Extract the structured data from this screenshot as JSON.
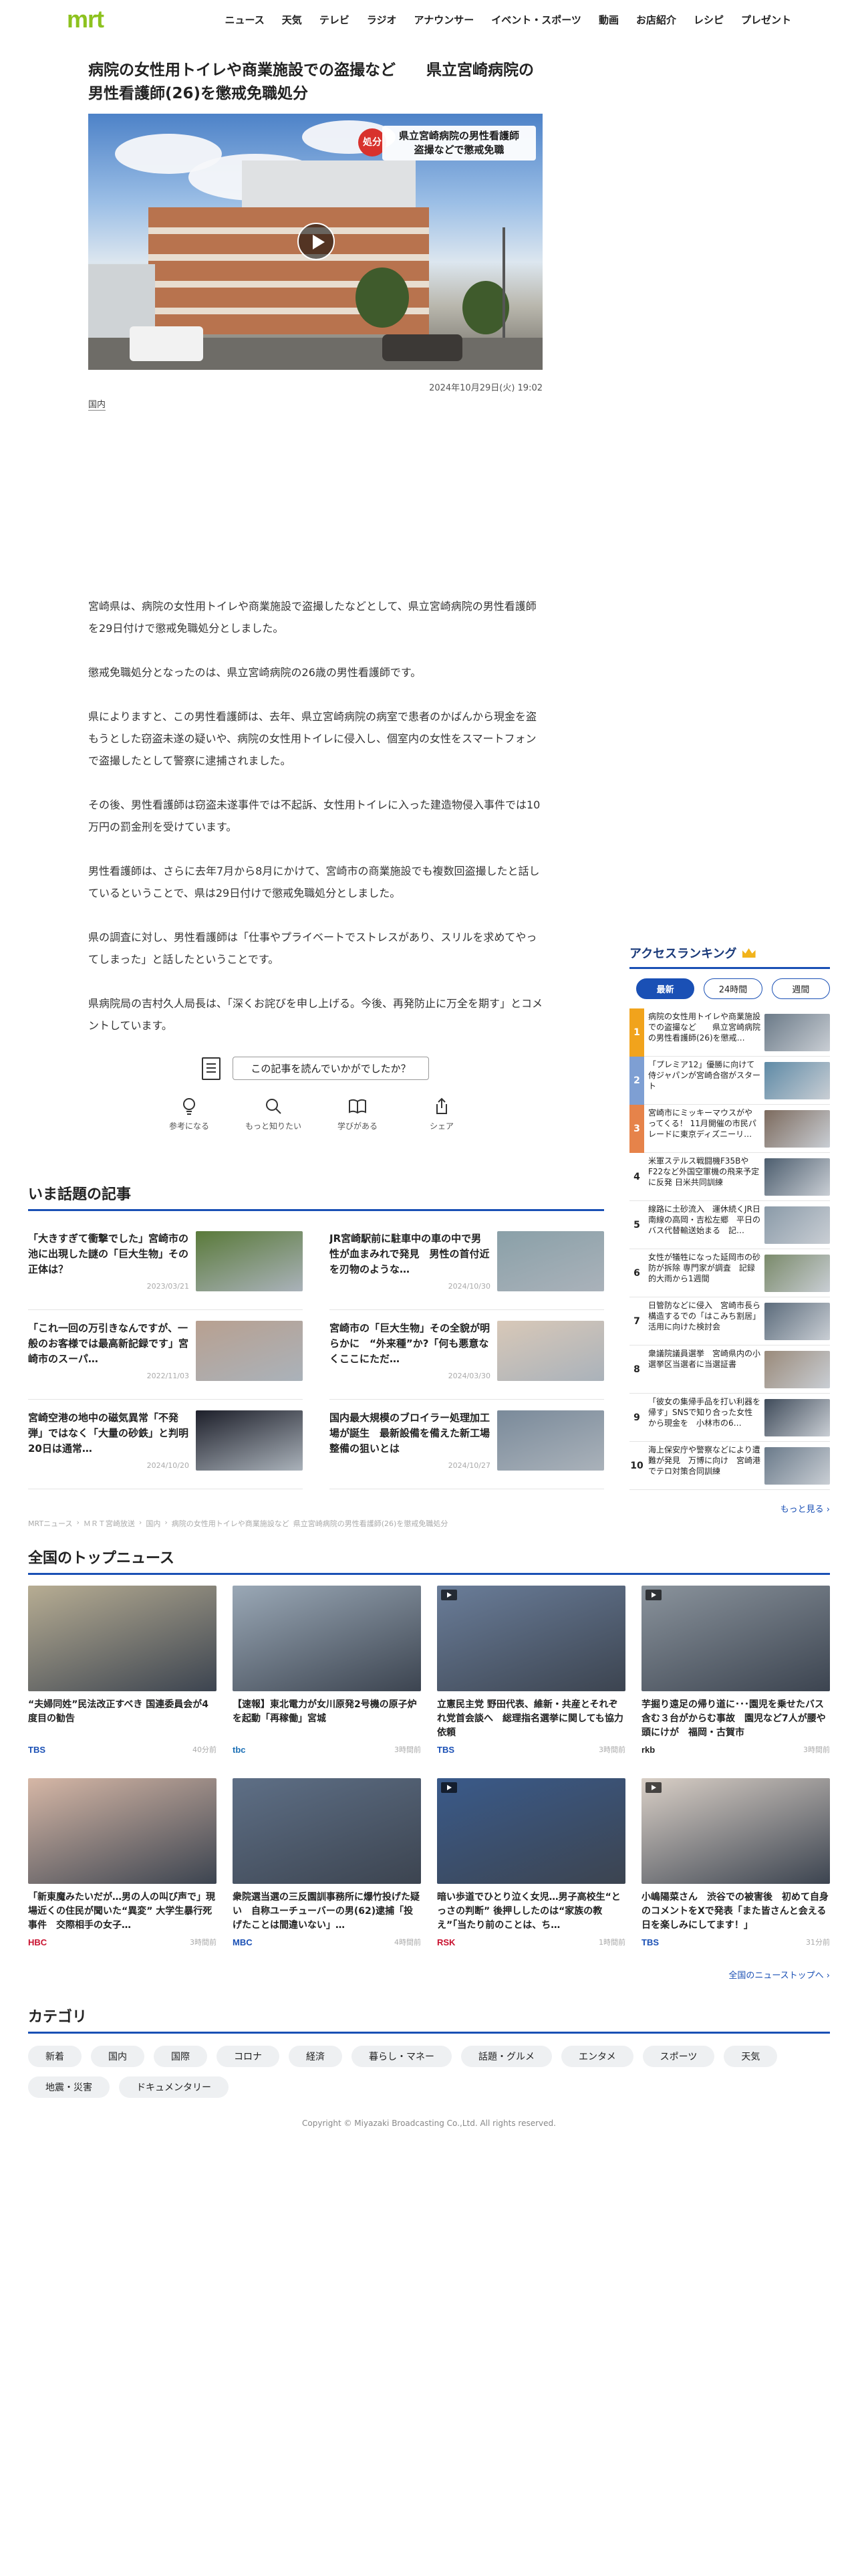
{
  "header": {
    "logo": "mrt",
    "nav": [
      "ニュース",
      "天気",
      "テレビ",
      "ラジオ",
      "アナウンサー",
      "イベント・スポーツ",
      "動画",
      "お店紹介",
      "レシピ",
      "プレゼント"
    ]
  },
  "article": {
    "title": "病院の女性用トイレや商業施設での盗撮など　　県立宮崎病院の男性看護師(26)を懲戒免職処分",
    "hero_tag": "処分",
    "hero_telop": "県立宮崎病院の男性看護師\n盗撮などで懲戒免職",
    "date": "2024年10月29日(火) 19:02",
    "category": "国内",
    "paragraphs": [
      "宮崎県は、病院の女性用トイレや商業施設で盗撮したなどとして、県立宮崎病院の男性看護師を29日付けで懲戒免職処分としました。",
      "懲戒免職処分となったのは、県立宮崎病院の26歳の男性看護師です。",
      "県によりますと、この男性看護師は、去年、県立宮崎病院の病室で患者のかばんから現金を盗もうとした窃盗未遂の疑いや、病院の女性用トイレに侵入し、個室内の女性をスマートフォンで盗撮したとして警察に逮捕されました。",
      "その後、男性看護師は窃盗未遂事件では不起訴、女性用トイレに入った建造物侵入事件では10万円の罰金刑を受けています。",
      "男性看護師は、さらに去年7月から8月にかけて、宮崎市の商業施設でも複数回盗撮したと話しているということで、県は29日付けで懲戒免職処分としました。",
      "県の調査に対し、男性看護師は「仕事やプライベートでストレスがあり、スリルを求めてやってしまった」と話したということです。",
      "県病院局の吉村久人局長は、「深くお詫びを申し上げる。今後、再発防止に万全を期す」とコメントしています。"
    ]
  },
  "feedback": {
    "question": "この記事を読んでいかがでしたか？",
    "actions": [
      "参考になる",
      "もっと知りたい",
      "学びがある",
      "シェア"
    ]
  },
  "ranking": {
    "title": "アクセスランキング",
    "tabs": [
      "最新",
      "24時間",
      "週間"
    ],
    "items": [
      {
        "rank": "1",
        "title": "病院の女性用トイレや商業施設での盗撮など　　県立宮崎病院の男性看護師(26)を懲戒…",
        "color": "#f1a31c"
      },
      {
        "rank": "2",
        "title": "「プレミア12」優勝に向けて侍ジャパンが宮崎合宿がスタート",
        "color": "#7e9fd3"
      },
      {
        "rank": "3",
        "title": "宮崎市にミッキーマウスがやってくる！ 11月開催の市民パレードに東京ディズニーリ…",
        "color": "#e6834a"
      },
      {
        "rank": "4",
        "title": "米軍ステルス戦闘機F35Bや F22など外国空軍機の飛来予定に反発 日米共同訓練",
        "color": ""
      },
      {
        "rank": "5",
        "title": "線路に土砂流入　運休続くJR日南線の高岡・吉松左郷　平日のバス代替輸送始まる　記…",
        "color": ""
      },
      {
        "rank": "6",
        "title": "女性が犠牲になった延岡市の砂防が拆除 専門家が調査　記録的大雨から1週間",
        "color": ""
      },
      {
        "rank": "7",
        "title": "日管防などに侵入　宮崎市長ら構造するでの「はこみち割居」活用に向けた検討会",
        "color": ""
      },
      {
        "rank": "8",
        "title": "衆議院議員選挙　宮崎県内の小選挙区当選者に当選証書",
        "color": ""
      },
      {
        "rank": "9",
        "title": "「彼女の集帰手品を打い利器を帰す」SNSで知り合った女性から現金を　小林市の6…",
        "color": ""
      },
      {
        "rank": "10",
        "title": "海上保安庁や警察などにより遭難が発見　万博に向け　宮崎港でテロ対策合同訓練",
        "color": ""
      }
    ],
    "more": "もっと見る ›"
  },
  "trending": {
    "title": "いま話題の記事",
    "items": [
      {
        "title": "「大きすぎて衝撃でした」宮崎市の池に出現した謎の「巨大生物」その正体は？",
        "date": "2023/03/21"
      },
      {
        "title": "JR宮崎駅前に駐車中の車の中で男性が血まみれで発見　男性の首付近を刃物のような…",
        "date": "2024/10/30"
      },
      {
        "title": "「これ一回の万引きなんですが、一般のお客様では最高新記録です」宮崎市のスーパ…",
        "date": "2022/11/03"
      },
      {
        "title": "宮崎市の「巨大生物」その全貌が明らかに　“外来種”か?「何も悪意なくここにただ…",
        "date": "2024/03/30"
      },
      {
        "title": "宮崎空港の地中の磁気異常「不発弾」ではなく「大量の砂鉄」と判明　20日は通常…",
        "date": "2024/10/20"
      },
      {
        "title": "国内最大規模のブロイラー処理加工場が誕生　最新設備を備えた新工場整備の狙いとは",
        "date": "2024/10/27"
      }
    ]
  },
  "breadcrumb": [
    "MRTニュース",
    "ＭＲＴ宮崎放送",
    "国内",
    "病院の女性用トイレや商業施設など",
    "県立宮崎病院の男性看護師(26)を懲戒免職処分"
  ],
  "national": {
    "title": "全国のトップニュース",
    "items": [
      {
        "title": "“夫婦同姓”民法改正すべき 国連委員会が4度目の勧告",
        "source": "TBS",
        "time": "40分前",
        "src_color": "#1a50b5"
      },
      {
        "title": "【速報】東北電力が女川原発2号機の原子炉を起動「再稼働」宮城",
        "source": "tbc",
        "time": "3時間前",
        "src_color": "#1a6fb5"
      },
      {
        "title": "立憲民主党 野田代表、維新・共産とそれぞれ党首会談へ　総理指名選挙に関しても協力依頼",
        "source": "TBS",
        "time": "3時間前",
        "src_color": "#1a50b5"
      },
      {
        "title": "芋掘り遠足の帰り道に･･･園児を乗せたバス含む３台がからむ事故　園児など7人が腰や頭にけが　福岡・古賀市",
        "source": "rkb",
        "time": "3時間前",
        "src_color": "#222"
      },
      {
        "title": "「新東魔みたいだが…男の人の叫び声で」現場近くの住民が聞いた“異変” 大学生暴行死事件　交際相手の女子…",
        "source": "HBC",
        "time": "3時間前",
        "src_color": "#c8102e"
      },
      {
        "title": "衆院選当選の三反園訓事務所に爆竹投げた疑い　自称ユーチューバーの男(62)逮捕「投げたことは間違いない」…",
        "source": "MBC",
        "time": "4時間前",
        "src_color": "#1a50b5"
      },
      {
        "title": "暗い歩道でひとり泣く女児…男子高校生“とっさの判断” 後押ししたのは“家族の教え”「当たり前のことは、ち…",
        "source": "RSK",
        "time": "1時間前",
        "src_color": "#c8102e"
      },
      {
        "title": "小嶋陽菜さん　渋谷での被害後　初めて自身のコメントをXで発表「また皆さんと会える日を楽しみにしてます！」",
        "source": "TBS",
        "time": "31分前",
        "src_color": "#1a50b5"
      }
    ],
    "more": "全国のニューストップへ ›"
  },
  "categories": {
    "title": "カテゴリ",
    "items": [
      "新着",
      "国内",
      "国際",
      "コロナ",
      "経済",
      "暮らし・マネー",
      "話題・グルメ",
      "エンタメ",
      "スポーツ",
      "天気",
      "地震・災害",
      "ドキュメンタリー"
    ]
  },
  "footer": {
    "copyright": "Copyright © Miyazaki Broadcasting Co.,Ltd. All rights reserved."
  }
}
